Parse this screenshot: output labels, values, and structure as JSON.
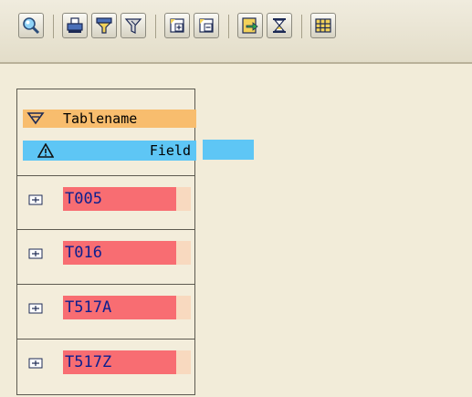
{
  "toolbar": {
    "buttons": [
      {
        "name": "find-icon"
      },
      {
        "name": "print-icon"
      },
      {
        "name": "filter-icon"
      },
      {
        "name": "filter-delete-icon"
      },
      {
        "name": "expand-node-icon"
      },
      {
        "name": "collapse-node-icon"
      },
      {
        "name": "export-icon"
      },
      {
        "name": "hourglass-icon"
      },
      {
        "name": "layout-grid-icon"
      }
    ]
  },
  "tree": {
    "header": {
      "level1_label": "Tablename",
      "level2_label": "Field"
    },
    "rows": [
      {
        "label": "T005"
      },
      {
        "label": "T016"
      },
      {
        "label": "T517A"
      },
      {
        "label": "T517Z"
      }
    ]
  },
  "colors": {
    "background": "#f2ecd9",
    "header_orange": "#f8bd6e",
    "header_blue": "#5ec6f5",
    "row_red": "#f86d72",
    "row_peach": "#f8d9bf",
    "row_text": "#0b1f8f"
  }
}
